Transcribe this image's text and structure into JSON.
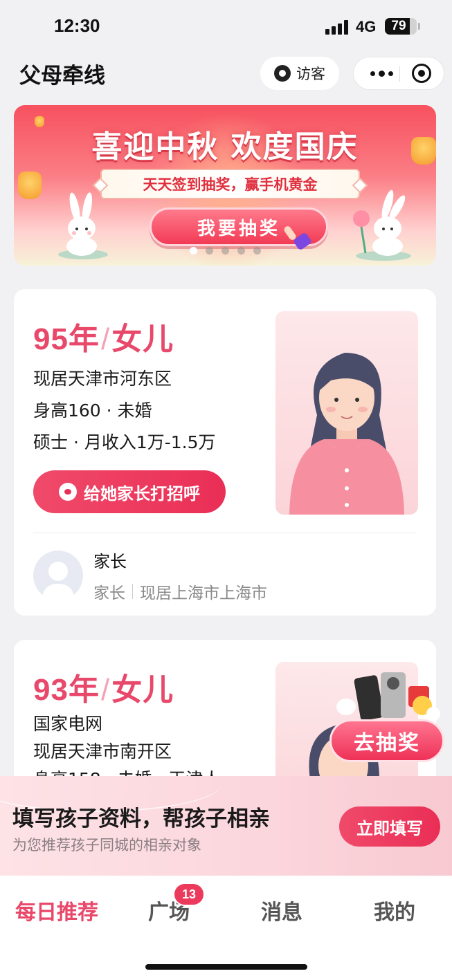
{
  "status_bar": {
    "time": "12:30",
    "network": "4G",
    "battery": "79",
    "battery_level": 0.79
  },
  "nav": {
    "title": "父母牵线",
    "visitor_label": "访客"
  },
  "banner": {
    "title": "喜迎中秋 欢度国庆",
    "subtitle": "天天签到抽奖，赢手机黄金",
    "button_label": "我要抽奖",
    "page_count": 5,
    "active_index": 0
  },
  "cards": [
    {
      "age_year": "95年",
      "slash": "/",
      "relation": "女儿",
      "lines": [
        "现居天津市河东区",
        "身高160 · 未婚",
        "硕士 · 月收入1万-1.5万"
      ],
      "greet_label": "给她家长打招呼",
      "parent_name": "家长",
      "parent_role": "家长",
      "parent_location": "现居上海市上海市"
    },
    {
      "age_year": "93年",
      "slash": "/",
      "relation": "女儿",
      "lines": [
        "国家电网",
        "现居天津市南开区",
        "身高158 · 未婚 · 天津人"
      ]
    }
  ],
  "lottery_float": {
    "label": "去抽奖"
  },
  "promo": {
    "title": "填写孩子资料，帮孩子相亲",
    "subtitle": "为您推荐孩子同城的相亲对象",
    "button_label": "立即填写"
  },
  "tabbar": {
    "tabs": [
      {
        "label": "每日推荐",
        "active": true
      },
      {
        "label": "广场",
        "active": false
      },
      {
        "label": "消息",
        "active": false
      },
      {
        "label": "我的",
        "active": false
      }
    ],
    "plaza_badge": "13"
  },
  "colors": {
    "accent": "#e8486a",
    "button": "#ea2e56",
    "background": "#f1f1f3"
  }
}
